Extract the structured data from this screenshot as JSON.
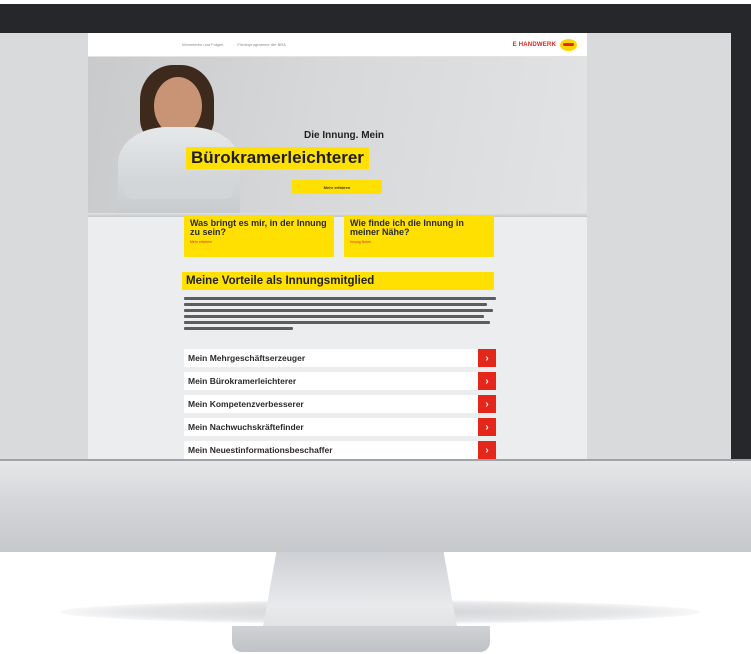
{
  "site": {
    "topbar": {
      "links": [
        "Informieren und Folgen",
        "Förderprogramme der BRA"
      ],
      "logo_text": "E HANDWERK"
    },
    "hero": {
      "headline_small": "Die Innung. Mein",
      "headline_big": "Bürokramerleichterer",
      "cta_label": "Mehr erfahren"
    },
    "cards": [
      {
        "title": "Was bringt es mir, in der Innung zu sein?",
        "link": "Mehr erfahren"
      },
      {
        "title": "Wie finde ich die Innung in meiner Nähe?",
        "link": "Innung finden"
      }
    ],
    "section_title": "Meine Vorteile als Innungsmitglied",
    "list": [
      "Mein Mehrgeschäftserzeuger",
      "Mein Bürokramerleichterer",
      "Mein Kompetenzverbesserer",
      "Mein Nachwuchskräftefinder",
      "Mein Neuestinformationsbeschaffer"
    ],
    "chevron_icon": "chevron-right-icon",
    "colors": {
      "accent_yellow": "#ffe000",
      "accent_red": "#e4261b"
    }
  }
}
